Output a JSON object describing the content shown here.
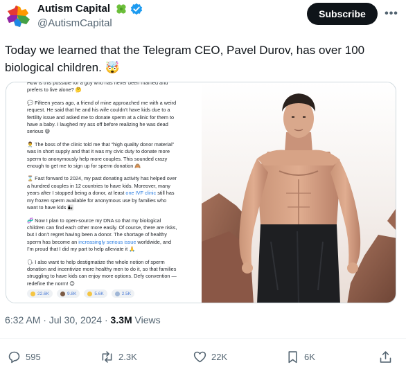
{
  "author": {
    "name": "Autism Capital",
    "handle": "@AutismCapital",
    "subscribe_label": "Subscribe",
    "more_label": "•••"
  },
  "tweet": {
    "text": "Today we learned that the Telegram CEO, Pavel Durov, has over 100 biological children. 🤯"
  },
  "screenshot": {
    "paragraphs": [
      "How is this possible for a guy who has never been married and prefers to live alone? 🤔",
      "💬 Fifteen years ago, a friend of mine approached me with a weird request. He said that he and his wife couldn’t have kids due to a fertility issue and asked me to donate sperm at a clinic for them to have a baby. I laughed my ass off before realizing he was dead serious 😅",
      "👨‍⚕️ The boss of the clinic told me that “high quality donor material” was in short supply and that it was my civic duty to donate more sperm to anonymously help more couples. This sounded crazy enough to get me to sign up for sperm donation 🙈",
      "⌛ Fast forward to 2024, my past donating activity has helped over a hundred couples in 12 countries to have kids. Moreover, many years after I stopped being a donor, at least ",
      "🧬 Now I plan to open-source my DNA so that my biological children can find each other more easily. Of course, there are risks, but I don’t regret having been a donor. The shortage of healthy sperm has become an ",
      "🗣 I also want to help destigmatize the whole notion of sperm donation and incentivize more healthy men to do it, so that families struggling to have kids can enjoy more options. Defy convention — redefine the norm! 😉"
    ],
    "link1": "one IVF clinic",
    "p4_tail": " still has my frozen sperm available for anonymous use by families who want to have kids 👨‍👧",
    "link2": "increasingly serious issue",
    "p5_tail": " worldwide, and I’m proud that I did my part to help alleviate it 🙏",
    "reactions": [
      "22.6K",
      "9.8K",
      "5.6K",
      "2.5K"
    ]
  },
  "meta": {
    "time": "6:32 AM · Jul 30, 2024 · ",
    "views_count": "3.3M",
    "views_label": " Views"
  },
  "actions": {
    "reply_count": "595",
    "repost_count": "2.3K",
    "like_count": "22K",
    "bookmark_count": "6K"
  },
  "colors": {
    "accent": "#1d9bf0",
    "text": "#0f1419",
    "muted": "#536471",
    "badge_green": "#6cbf3a"
  }
}
